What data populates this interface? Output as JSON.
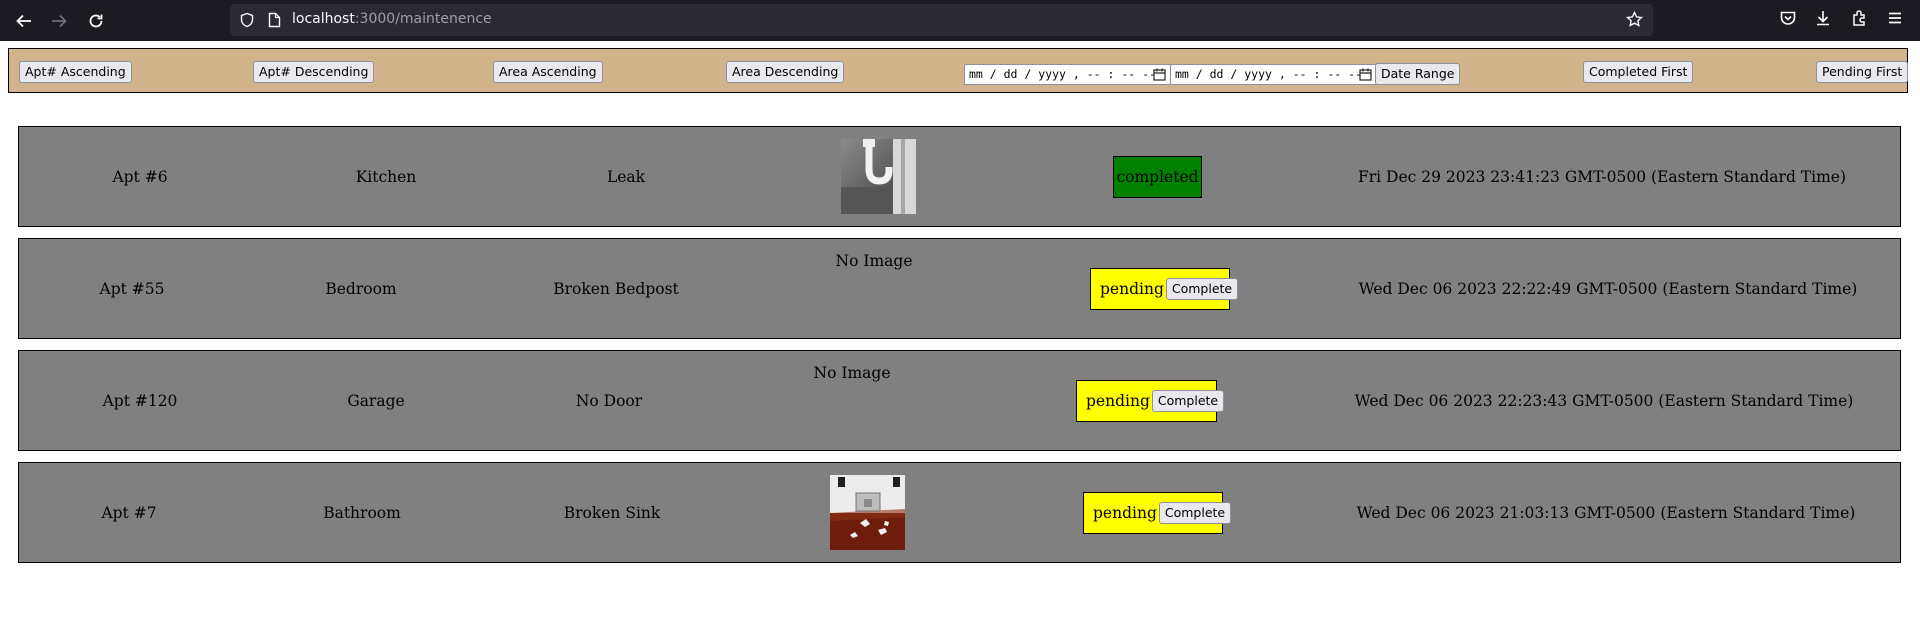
{
  "browser": {
    "url_host": "localhost",
    "url_path": ":3000/maintenence"
  },
  "toolbar": {
    "apt_asc": "Apt# Ascending",
    "apt_desc": "Apt# Descending",
    "area_asc": "Area Ascending",
    "area_desc": "Area Descending",
    "date_placeholder": "mm / dd / yyyy ,  -- : --   --",
    "date_range": "Date Range",
    "completed_first": "Completed First",
    "pending_first": "Pending First"
  },
  "requests": [
    {
      "apt": "Apt #6",
      "area": "Kitchen",
      "issue": "Leak",
      "image": "pipe-photo",
      "status": "completed",
      "date": "Fri Dec 29 2023 23:41:23 GMT-0500 (Eastern Standard Time)"
    },
    {
      "apt": "Apt #55",
      "area": "Bedroom",
      "issue": "Broken Bedpost",
      "image_text": "No Image",
      "status": "pending",
      "action": "Complete",
      "date": "Wed Dec 06 2023 22:22:49 GMT-0500 (Eastern Standard Time)"
    },
    {
      "apt": "Apt #120",
      "area": "Garage",
      "issue": "No Door",
      "image_text": "No Image",
      "status": "pending",
      "action": "Complete",
      "date": "Wed Dec 06 2023 22:23:43 GMT-0500 (Eastern Standard Time)"
    },
    {
      "apt": "Apt #7",
      "area": "Bathroom",
      "issue": "Broken Sink",
      "image": "sink-photo",
      "status": "pending",
      "action": "Complete",
      "date": "Wed Dec 06 2023 21:03:13 GMT-0500 (Eastern Standard Time)"
    }
  ],
  "colors": {
    "toolbar_bg": "#d2b48c",
    "row_bg": "#808080",
    "completed": "#008000",
    "pending": "#ffff00"
  }
}
